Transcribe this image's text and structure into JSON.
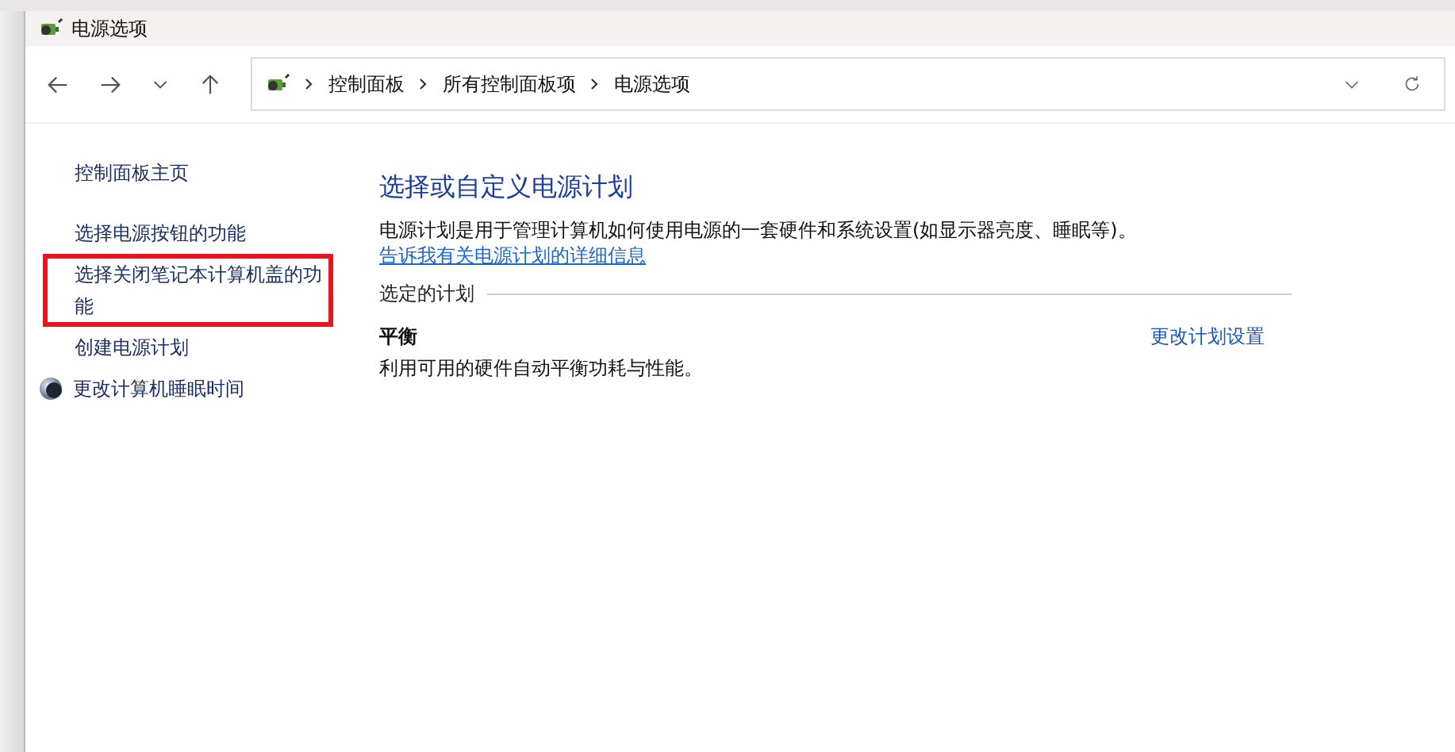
{
  "window": {
    "title": "电源选项"
  },
  "address_bar": {
    "breadcrumbs": [
      "控制面板",
      "所有控制面板项",
      "电源选项"
    ]
  },
  "sidebar": {
    "items": [
      {
        "label": "控制面板主页",
        "kind": "plain",
        "highlighted": false
      },
      {
        "label": "选择电源按钮的功能",
        "kind": "plain",
        "highlighted": false
      },
      {
        "label": "选择关闭笔记本计算机盖的功能",
        "kind": "plain",
        "highlighted": true
      },
      {
        "label": "创建电源计划",
        "kind": "plain",
        "highlighted": false
      },
      {
        "label": "更改计算机睡眠时间",
        "kind": "icon",
        "highlighted": false
      }
    ]
  },
  "main": {
    "title": "选择或自定义电源计划",
    "description": "电源计划是用于管理计算机如何使用电源的一套硬件和系统设置(如显示器亮度、睡眠等)。",
    "description_link": "告诉我有关电源计划的详细信息",
    "section_label": "选定的计划",
    "plans": [
      {
        "name": "平衡",
        "description": "利用可用的硬件自动平衡功耗与性能。",
        "action": "更改计划设置"
      }
    ]
  }
}
